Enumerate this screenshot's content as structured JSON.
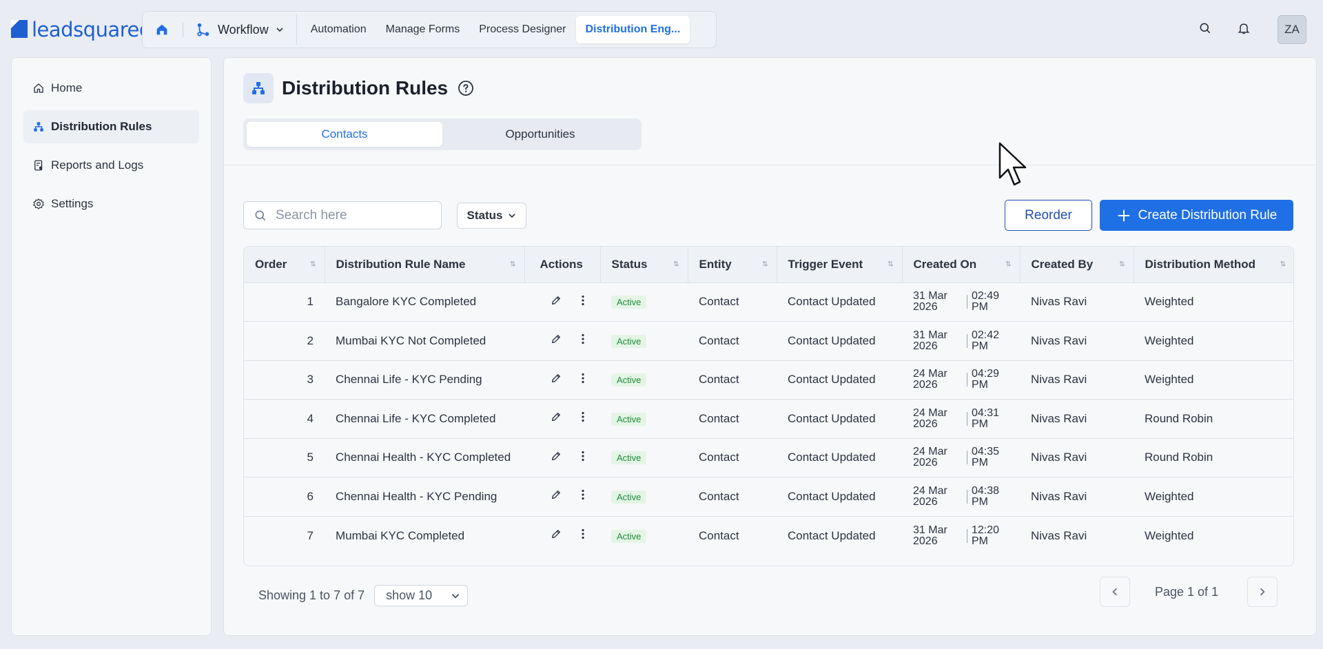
{
  "brand": {
    "logo_text": "leadsquared"
  },
  "topnav": {
    "workflow_label": "Workflow",
    "links": [
      {
        "label": "Automation"
      },
      {
        "label": "Manage Forms"
      },
      {
        "label": "Process Designer"
      },
      {
        "label": "Distribution Eng..."
      }
    ],
    "avatar_initials": "ZA"
  },
  "sidebar": {
    "items": [
      {
        "label": "Home",
        "icon": "home-icon"
      },
      {
        "label": "Distribution Rules",
        "icon": "distribution-icon"
      },
      {
        "label": "Reports and Logs",
        "icon": "reports-icon"
      },
      {
        "label": "Settings",
        "icon": "gear-icon"
      }
    ]
  },
  "page": {
    "title": "Distribution Rules",
    "tabs": [
      {
        "label": "Contacts"
      },
      {
        "label": "Opportunities"
      }
    ]
  },
  "toolbar": {
    "search_placeholder": "Search here",
    "status_filter_label": "Status",
    "reorder_label": "Reorder",
    "create_label": "Create Distribution Rule"
  },
  "table": {
    "headers": {
      "order": "Order",
      "name": "Distribution Rule Name",
      "actions": "Actions",
      "status": "Status",
      "entity": "Entity",
      "trigger": "Trigger Event",
      "created_on": "Created On",
      "created_by": "Created By",
      "method": "Distribution Method"
    },
    "rows": [
      {
        "order": "1",
        "name": "Bangalore KYC Completed",
        "status": "Active",
        "entity": "Contact",
        "trigger": "Contact Updated",
        "date_l1": "31 Mar",
        "date_l2": "2026",
        "time_l1": "02:49",
        "time_l2": "PM",
        "created_by": "Nivas Ravi",
        "method": "Weighted"
      },
      {
        "order": "2",
        "name": "Mumbai KYC Not Completed",
        "status": "Active",
        "entity": "Contact",
        "trigger": "Contact Updated",
        "date_l1": "31 Mar",
        "date_l2": "2026",
        "time_l1": "02:42",
        "time_l2": "PM",
        "created_by": "Nivas Ravi",
        "method": "Weighted"
      },
      {
        "order": "3",
        "name": "Chennai Life - KYC Pending",
        "status": "Active",
        "entity": "Contact",
        "trigger": "Contact Updated",
        "date_l1": "24 Mar",
        "date_l2": "2026",
        "time_l1": "04:29",
        "time_l2": "PM",
        "created_by": "Nivas Ravi",
        "method": "Weighted"
      },
      {
        "order": "4",
        "name": "Chennai Life - KYC Completed",
        "status": "Active",
        "entity": "Contact",
        "trigger": "Contact Updated",
        "date_l1": "24 Mar",
        "date_l2": "2026",
        "time_l1": "04:31",
        "time_l2": "PM",
        "created_by": "Nivas Ravi",
        "method": "Round Robin"
      },
      {
        "order": "5",
        "name": "Chennai Health - KYC Completed",
        "status": "Active",
        "entity": "Contact",
        "trigger": "Contact Updated",
        "date_l1": "24 Mar",
        "date_l2": "2026",
        "time_l1": "04:35",
        "time_l2": "PM",
        "created_by": "Nivas Ravi",
        "method": "Round Robin"
      },
      {
        "order": "6",
        "name": "Chennai Health - KYC Pending",
        "status": "Active",
        "entity": "Contact",
        "trigger": "Contact Updated",
        "date_l1": "24 Mar",
        "date_l2": "2026",
        "time_l1": "04:38",
        "time_l2": "PM",
        "created_by": "Nivas Ravi",
        "method": "Weighted"
      },
      {
        "order": "7",
        "name": "Mumbai KYC Completed",
        "status": "Active",
        "entity": "Contact",
        "trigger": "Contact Updated",
        "date_l1": "31 Mar",
        "date_l2": "2026",
        "time_l1": "12:20",
        "time_l2": "PM",
        "created_by": "Nivas Ravi",
        "method": "Weighted"
      }
    ]
  },
  "footer": {
    "showing_text": "Showing 1 to 7 of 7",
    "page_size": "show 10",
    "page_label": "Page 1 of 1"
  },
  "colors": {
    "accent": "#1f6fe5",
    "brand": "#1f5fd1",
    "active_badge_bg": "#e4f5e6",
    "active_badge_fg": "#1f8a3a"
  }
}
